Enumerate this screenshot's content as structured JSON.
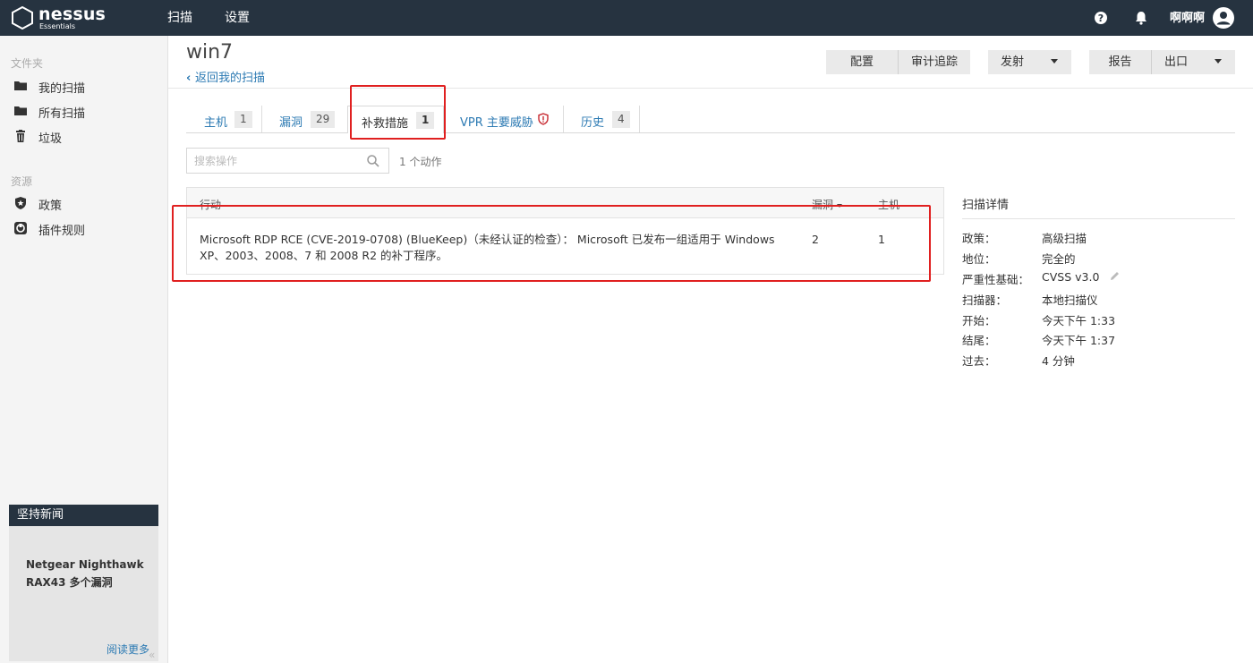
{
  "app": {
    "brand": "nessus",
    "edition": "Essentials"
  },
  "topnav": {
    "scans": "扫描",
    "settings": "设置",
    "username": "啊啊啊"
  },
  "sidebar": {
    "folders_label": "文件夹",
    "folders": [
      "我的扫描",
      "所有扫描",
      "垃圾"
    ],
    "resources_label": "资源",
    "resources": [
      "政策",
      "插件规则"
    ],
    "news": {
      "header": "坚持新闻",
      "title": "Netgear Nighthawk RAX43 多个漏洞",
      "read_more": "阅读更多"
    },
    "collapse": "«"
  },
  "header": {
    "title": "win7",
    "back": "返回我的扫描",
    "buttons": {
      "configure": "配置",
      "audit_trail": "审计追踪",
      "launch": "发射",
      "report": "报告",
      "export": "出口"
    }
  },
  "tabs": [
    {
      "label": "主机",
      "count": "1"
    },
    {
      "label": "漏洞",
      "count": "29"
    },
    {
      "label": "补救措施",
      "count": "1"
    },
    {
      "label": "VPR 主要威胁",
      "count": ""
    },
    {
      "label": "历史",
      "count": "4"
    }
  ],
  "search": {
    "placeholder": "搜索操作",
    "count_text": "1 个动作"
  },
  "table": {
    "columns": [
      "行动",
      "漏洞",
      "主机"
    ],
    "rows": [
      {
        "action": "Microsoft RDP RCE (CVE-2019-0708) (BlueKeep)（未经认证的检查）： Microsoft 已发布一组适用于 Windows XP、2003、2008、7 和 2008 R2 的补丁程序。",
        "vulns": "2",
        "hosts": "1"
      }
    ]
  },
  "details": {
    "title": "扫描详情",
    "items": [
      {
        "label": "政策：",
        "value": "高级扫描"
      },
      {
        "label": "地位：",
        "value": "完全的"
      },
      {
        "label": "严重性基础：",
        "value": "CVSS v3.0"
      },
      {
        "label": "扫描器：",
        "value": "本地扫描仪"
      },
      {
        "label": "开始：",
        "value": "今天下午 1:33"
      },
      {
        "label": "结尾：",
        "value": "今天下午 1:37"
      },
      {
        "label": "过去：",
        "value": "4 分钟"
      }
    ]
  },
  "colors": {
    "topbar": "#263340",
    "link": "#2c7ab3",
    "annotation": "#e02020"
  }
}
